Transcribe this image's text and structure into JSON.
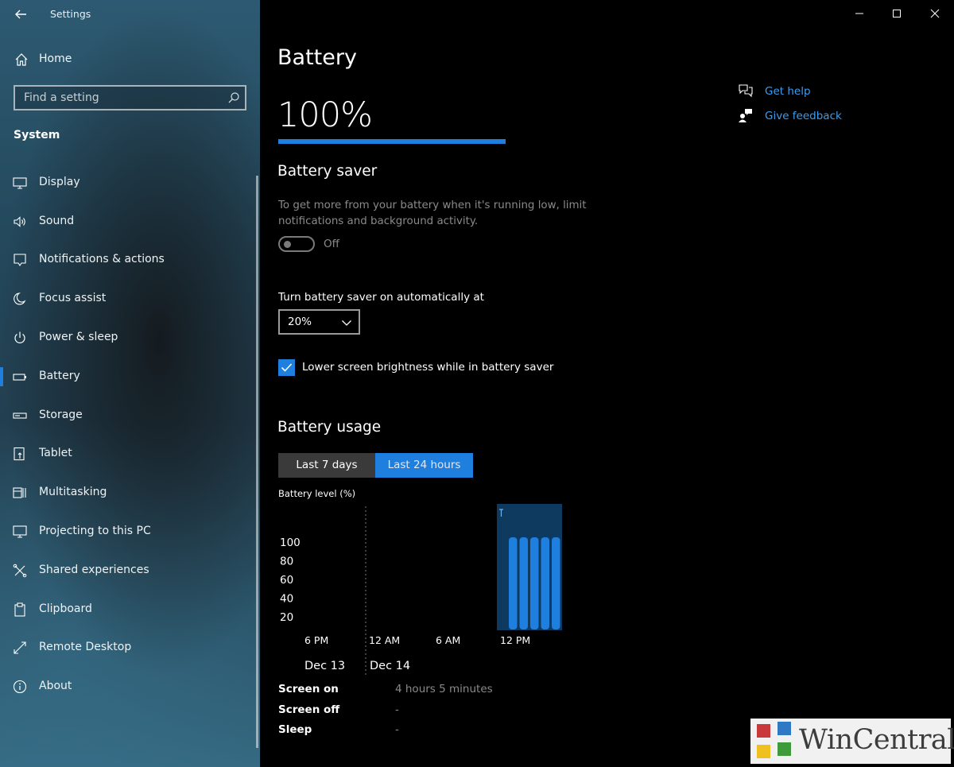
{
  "window": {
    "title": "Settings"
  },
  "sidebar": {
    "home_label": "Home",
    "search_placeholder": "Find a setting",
    "section_title": "System",
    "items": [
      {
        "label": "Display",
        "icon": "monitor-icon"
      },
      {
        "label": "Sound",
        "icon": "speaker-icon"
      },
      {
        "label": "Notifications & actions",
        "icon": "notification-icon"
      },
      {
        "label": "Focus assist",
        "icon": "moon-icon"
      },
      {
        "label": "Power & sleep",
        "icon": "power-icon"
      },
      {
        "label": "Battery",
        "icon": "battery-icon",
        "selected": true
      },
      {
        "label": "Storage",
        "icon": "storage-icon"
      },
      {
        "label": "Tablet",
        "icon": "tablet-icon"
      },
      {
        "label": "Multitasking",
        "icon": "multitasking-icon"
      },
      {
        "label": "Projecting to this PC",
        "icon": "projecting-icon"
      },
      {
        "label": "Shared experiences",
        "icon": "shared-experiences-icon"
      },
      {
        "label": "Clipboard",
        "icon": "clipboard-icon"
      },
      {
        "label": "Remote Desktop",
        "icon": "remote-desktop-icon"
      },
      {
        "label": "About",
        "icon": "info-icon"
      }
    ]
  },
  "main": {
    "title": "Battery",
    "battery_percent": "100%",
    "battery_level": 1.0,
    "battery_saver": {
      "heading": "Battery saver",
      "description": "To get more from your battery when it's running low, limit notifications and background activity.",
      "toggle_state": "Off",
      "auto_label": "Turn battery saver on automatically at",
      "auto_value": "20%",
      "brightness_label": "Lower screen brightness while in battery saver",
      "brightness_checked": true
    },
    "battery_usage": {
      "heading": "Battery usage",
      "tabs": [
        {
          "label": "Last 7 days",
          "selected": false
        },
        {
          "label": "Last 24 hours",
          "selected": true
        }
      ],
      "chart_caption": "Battery level (%)"
    },
    "stats": [
      {
        "label": "Screen on",
        "value": "4 hours 5 minutes"
      },
      {
        "label": "Screen off",
        "value": "-"
      },
      {
        "label": "Sleep",
        "value": "-"
      }
    ],
    "help_links": {
      "get_help": "Get help",
      "give_feedback": "Give feedback"
    }
  },
  "chart_data": {
    "type": "bar",
    "title": "Battery level (%)",
    "y_ticks": [
      "100",
      "80",
      "60",
      "40",
      "20"
    ],
    "ylim": [
      0,
      100
    ],
    "x_ticks": [
      "6 PM",
      "12 AM",
      "6 AM",
      "12 PM"
    ],
    "date_labels": [
      "Dec 13",
      "Dec 14"
    ],
    "series": [
      {
        "values": [
          100,
          100,
          100,
          100,
          100
        ]
      }
    ],
    "charging_marker": true
  },
  "watermark": {
    "text": "WinCentral"
  },
  "colors": {
    "accent": "#1f7fde",
    "link": "#3b9cf0",
    "muted_text": "#8a8a8a"
  }
}
